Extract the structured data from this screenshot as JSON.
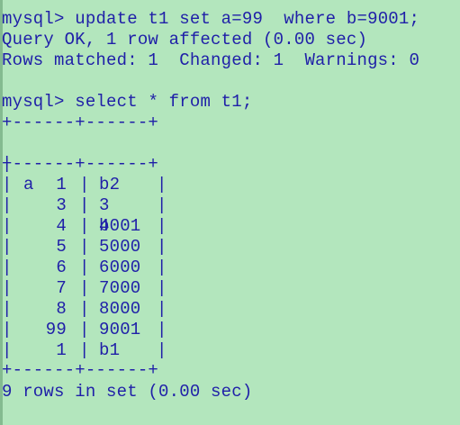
{
  "terminal": {
    "lines": [
      {
        "prompt": "mysql>",
        "command": "update t1 set a=99  where b=9001;"
      },
      {
        "text": "Query OK, 1 row affected (0.00 sec)"
      },
      {
        "text": "Rows matched: 1  Changed: 1  Warnings: 0"
      },
      {
        "prompt": "mysql>",
        "command": "select * from t1;"
      }
    ],
    "table": {
      "border": "+------+------+",
      "columns": [
        "a",
        "b"
      ],
      "rows": [
        [
          "1",
          "b2"
        ],
        [
          "3",
          "3"
        ],
        [
          "4",
          "4001"
        ],
        [
          "5",
          "5000"
        ],
        [
          "6",
          "6000"
        ],
        [
          "7",
          "7000"
        ],
        [
          "8",
          "8000"
        ],
        [
          "99",
          "9001"
        ],
        [
          "1",
          "b1"
        ]
      ]
    },
    "footer": "9 rows in set (0.00 sec)"
  },
  "colors": {
    "background": "#b3e6bd",
    "text": "#1f1fa8"
  }
}
